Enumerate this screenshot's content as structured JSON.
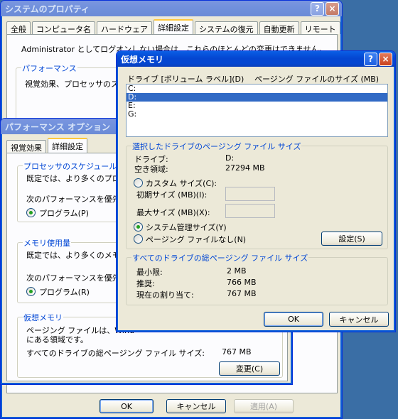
{
  "sysprops": {
    "title": "システムのプロパティ",
    "help": "?",
    "close": "×",
    "tabs": [
      "全般",
      "コンピュータ名",
      "ハードウェア",
      "詳細設定",
      "システムの復元",
      "自動更新",
      "リモート"
    ],
    "active_tab": 3,
    "admin_text": "Administrator としてログオンしない場合は、これらのほとんどの変更はできません。",
    "perf_group": "パフォーマンス",
    "perf_text": "視覚効果、プロセッサのスケ",
    "ok": "OK",
    "cancel": "キャンセル",
    "apply": "適用(A)"
  },
  "perfopts": {
    "title": "パフォーマンス オプション",
    "tabs": [
      "視覚効果",
      "詳細設定"
    ],
    "active_tab": 1,
    "sched_group": "プロセッサのスケジュール",
    "sched_text": "既定では、より多くのプロセ",
    "sched_prio": "次のパフォーマンスを優先す",
    "sched_program": "プログラム(P)",
    "mem_group": "メモリ使用量",
    "mem_text": "既定では、より多くのメモリを",
    "mem_prio": "次のパフォーマンスを優先す",
    "mem_program": "プログラム(R)",
    "vm_group": "仮想メモリ",
    "vm_text1": "ページング ファイルは、Wind",
    "vm_text2": "にある領域です。",
    "vm_total_label": "すべてのドライブの総ページング ファイル サイズ:",
    "vm_total_value": "767 MB",
    "change": "変更(C)"
  },
  "vmem": {
    "title": "仮想メモリ",
    "help": "?",
    "close": "×",
    "col_drive": "ドライブ [ボリューム ラベル](D)",
    "col_size": "ページング ファイルのサイズ (MB)",
    "drives": [
      "C:",
      "D:",
      "E:",
      "G:"
    ],
    "selected_drive": 1,
    "sel_group": "選択したドライブのページング ファイル サイズ",
    "drive_label": "ドライブ:",
    "drive_value": "D:",
    "free_label": "空き領域:",
    "free_value": "27294 MB",
    "custom": "カスタム サイズ(C):",
    "initial": "初期サイズ (MB)(I):",
    "max": "最大サイズ (MB)(X):",
    "system": "システム管理サイズ(Y)",
    "none": "ページング ファイルなし(N)",
    "set": "設定(S)",
    "total_group": "すべてのドライブの総ページング ファイル サイズ",
    "min_label": "最小限:",
    "min_value": "2 MB",
    "rec_label": "推奨:",
    "rec_value": "766 MB",
    "cur_label": "現在の割り当て:",
    "cur_value": "767 MB",
    "ok": "OK",
    "cancel": "キャンセル"
  }
}
